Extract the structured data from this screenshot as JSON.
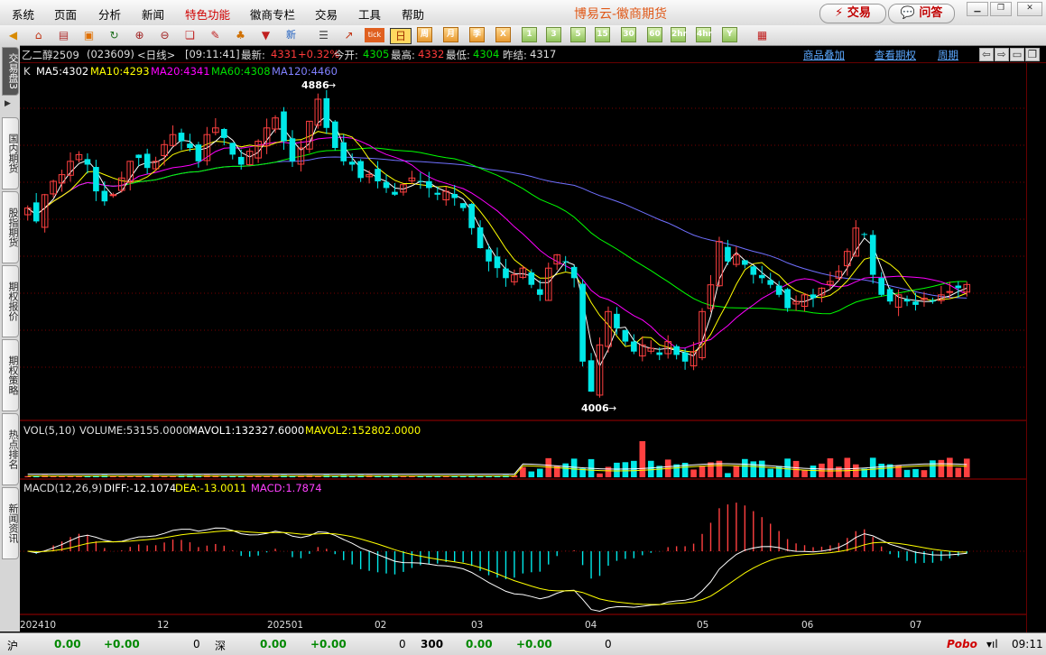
{
  "menu": {
    "items": [
      "系统",
      "页面",
      "分析",
      "新闻",
      "特色功能",
      "徽商专栏",
      "交易",
      "工具",
      "帮助"
    ],
    "app_title": "博易云-徽商期货",
    "trade_label": "交易",
    "qa_label": "问答"
  },
  "toolbar": {
    "tick_label": "tick",
    "day_label": "日",
    "week_label": "周",
    "month_label": "月",
    "season_label": "季",
    "x_label": "X",
    "periods": [
      "1",
      "3",
      "5",
      "15",
      "30",
      "60",
      "2hr",
      "4hr",
      "Y"
    ]
  },
  "sidetabs": [
    "交易盘3",
    "国内期货",
    "股指期货",
    "期权报价",
    "期权策略",
    "热点排名",
    "新闻资讯"
  ],
  "instrument": {
    "name": "乙二醇2509",
    "code": "(023609)",
    "period": "<日线>",
    "time": "[09:11:41]",
    "last_label": "最新:",
    "last": "4331",
    "change": "+0.32%",
    "open_label": "今开:",
    "open": "4305",
    "high_label": "最高:",
    "high": "4332",
    "low_label": "最低:",
    "low": "4304",
    "prev_label": "昨结:",
    "prev": "4317"
  },
  "links": {
    "overlay": "商品叠加",
    "options": "查看期权",
    "period": "周期"
  },
  "ma": {
    "k": "K",
    "ma5": "MA5:4302",
    "ma10": "MA10:4293",
    "ma20": "MA20:4341",
    "ma60": "MA60:4308",
    "ma120": "MA120:4460",
    "colors": {
      "ma5": "#ffffff",
      "ma10": "#ffff00",
      "ma20": "#ff00ff",
      "ma60": "#00ff00",
      "ma120": "#7070ff"
    }
  },
  "annotations": {
    "high": "4886",
    "low": "4006"
  },
  "volume": {
    "title": "VOL(5,10)",
    "volume": "VOLUME:53155.0000",
    "mavol1": "MAVOL1:132327.6000",
    "mavol2": "MAVOL2:152802.0000"
  },
  "macd": {
    "title": "MACD(12,26,9)",
    "diff": "DIFF:-12.1074",
    "dea": "DEA:-13.0011",
    "macd": "MACD:1.7874"
  },
  "xaxis": [
    "202410",
    "12",
    "202501",
    "02",
    "03",
    "04",
    "05",
    "06",
    "07"
  ],
  "status": {
    "sh_label": "沪",
    "sh_v1": "0.00",
    "sh_v2": "+0.00",
    "sh_v3": "0",
    "sz_label": "深",
    "sz_v1": "0.00",
    "sz_v2": "+0.00",
    "sz_v3": "0",
    "c300_label": "300",
    "c300_v1": "0.00",
    "c300_v2": "+0.00",
    "c300_v3": "0",
    "brand": "Pobo",
    "clock": "09:11"
  },
  "chart_data": {
    "type": "candlestick",
    "series_closes": [
      4560,
      4520,
      4600,
      4640,
      4660,
      4700,
      4720,
      4690,
      4610,
      4580,
      4600,
      4650,
      4700,
      4710,
      4680,
      4700,
      4750,
      4780,
      4760,
      4740,
      4700,
      4780,
      4800,
      4770,
      4720,
      4690,
      4730,
      4760,
      4800,
      4830,
      4760,
      4700,
      4740,
      4820,
      4886,
      4800,
      4740,
      4700,
      4690,
      4650,
      4660,
      4640,
      4620,
      4600,
      4630,
      4650,
      4640,
      4620,
      4600,
      4610,
      4590,
      4560,
      4500,
      4440,
      4400,
      4380,
      4350,
      4360,
      4380,
      4330,
      4300,
      4380,
      4420,
      4400,
      4350,
      4100,
      4010,
      4150,
      4250,
      4200,
      4160,
      4130,
      4150,
      4140,
      4120,
      4160,
      4120,
      4100,
      4130,
      4250,
      4330,
      4460,
      4400,
      4420,
      4390,
      4360,
      4350,
      4330,
      4300,
      4260,
      4280,
      4300,
      4290,
      4320,
      4340,
      4370,
      4430,
      4500,
      4480,
      4360,
      4300,
      4280,
      4300,
      4280,
      4270,
      4290,
      4280,
      4300,
      4310,
      4320,
      4331
    ],
    "ylim": [
      4006,
      4886
    ]
  }
}
